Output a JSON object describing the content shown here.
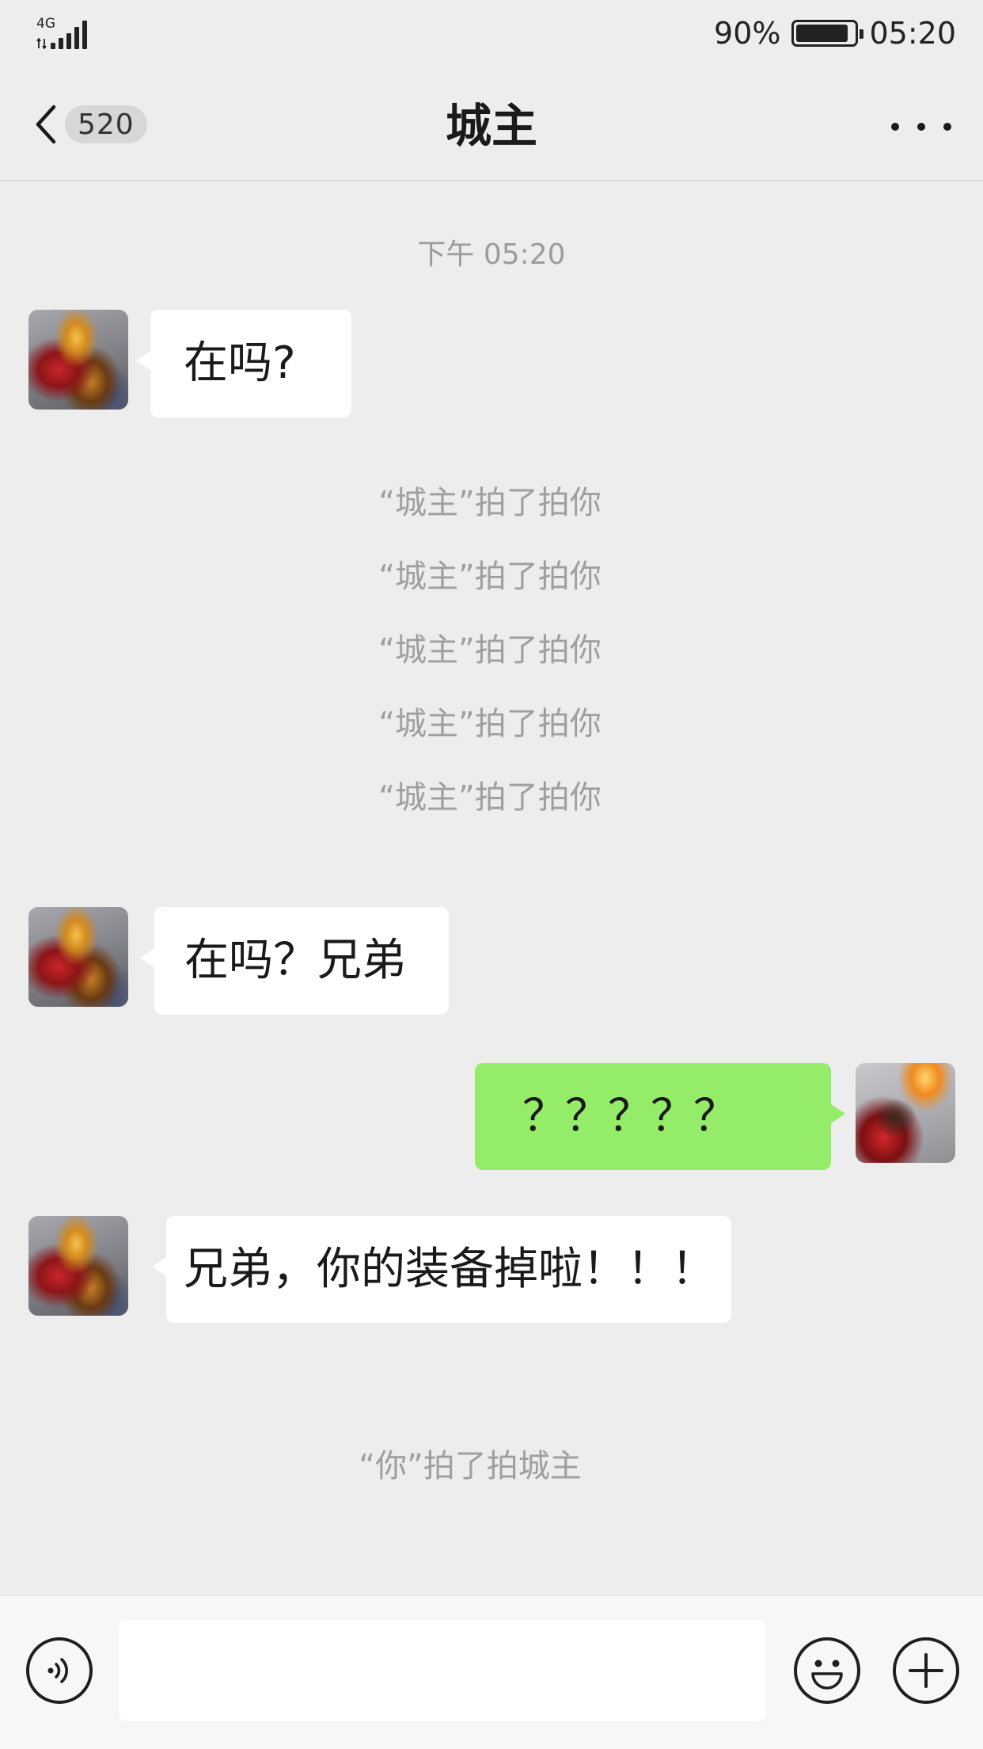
{
  "status_bar": {
    "network": "4G",
    "battery": "90%",
    "battery_level": 0.9,
    "time": "05:20"
  },
  "nav": {
    "back_count": "520",
    "title": "城主"
  },
  "chat": {
    "timestamp": "下午 05:20",
    "msg1": "在吗?",
    "pats": [
      "“城主”拍了拍你",
      "“城主”拍了拍你",
      "“城主”拍了拍你",
      "“城主”拍了拍你",
      "“城主”拍了拍你"
    ],
    "msg2": "在吗？兄弟",
    "msg3": "？？？？？",
    "msg4": "兄弟，你的装备掉啦！！！",
    "my_pat": "“你”拍了拍城主"
  },
  "input": {
    "value": "",
    "placeholder": ""
  }
}
